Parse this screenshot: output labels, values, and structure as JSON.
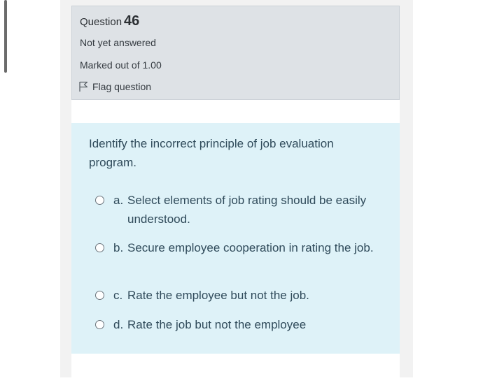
{
  "question": {
    "label": "Question",
    "number": "46",
    "state": "Not yet answered",
    "grade": "Marked out of 1.00",
    "flag_label": "Flag question",
    "flag_icon": "flag-icon",
    "text": "Identify the incorrect principle of job evaluation program.",
    "options": [
      {
        "letter": "a.",
        "text": "Select elements of job rating should be easily understood.",
        "selected": false
      },
      {
        "letter": "b.",
        "text": "Secure employee cooperation in rating the job.",
        "selected": false
      },
      {
        "letter": "c.",
        "text": "Rate the employee but not the job.",
        "selected": false
      },
      {
        "letter": "d.",
        "text": "Rate the job but not the employee",
        "selected": false
      }
    ]
  },
  "colors": {
    "info_background": "#dee2e6",
    "content_background": "#def2f8",
    "text": "#2f4a5a"
  }
}
